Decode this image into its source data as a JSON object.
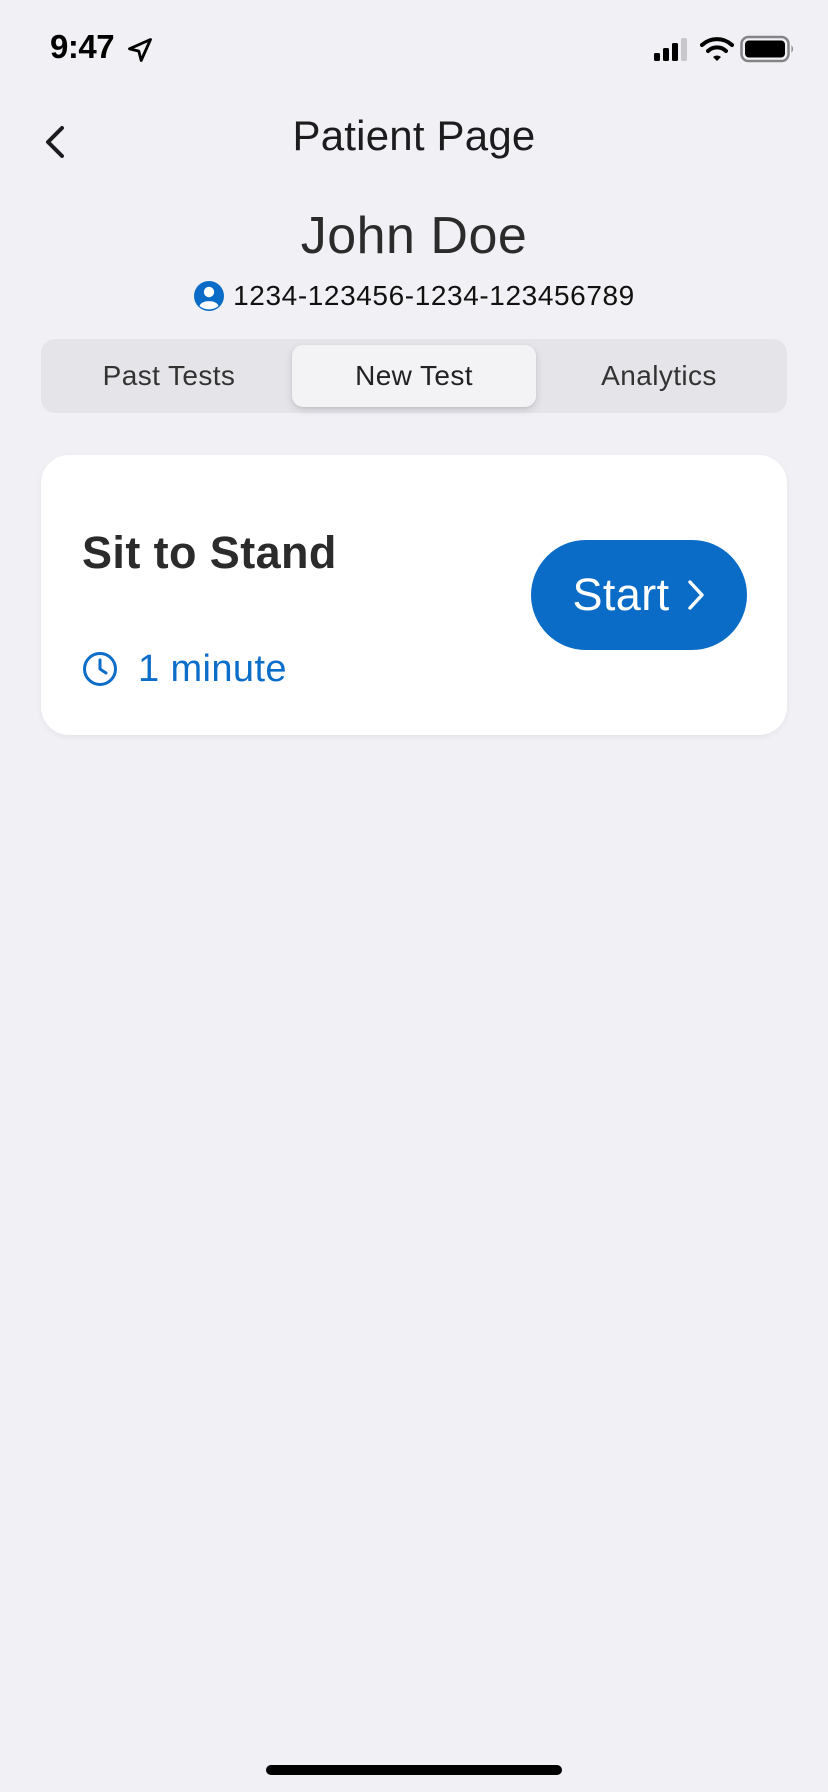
{
  "status_bar": {
    "time": "9:47",
    "icons": [
      "location-arrow-icon",
      "cellular-signal-icon",
      "wifi-icon",
      "battery-icon"
    ]
  },
  "nav": {
    "title": "Patient Page",
    "back_icon": "chevron-left-icon"
  },
  "patient": {
    "name": "John Doe",
    "id": "1234-123456-1234-123456789",
    "id_icon": "person-circle-icon"
  },
  "tabs": [
    {
      "label": "Past Tests",
      "selected": false
    },
    {
      "label": "New Test",
      "selected": true
    },
    {
      "label": "Analytics",
      "selected": false
    }
  ],
  "test_card": {
    "name": "Sit to Stand",
    "duration": "1 minute",
    "duration_icon": "clock-icon",
    "start_label": "Start",
    "start_icon": "chevron-right-icon"
  },
  "colors": {
    "background": "#f0f0f5",
    "accent": "#0b6cc7",
    "card": "#ffffff",
    "segment_track": "#e4e4e9"
  }
}
